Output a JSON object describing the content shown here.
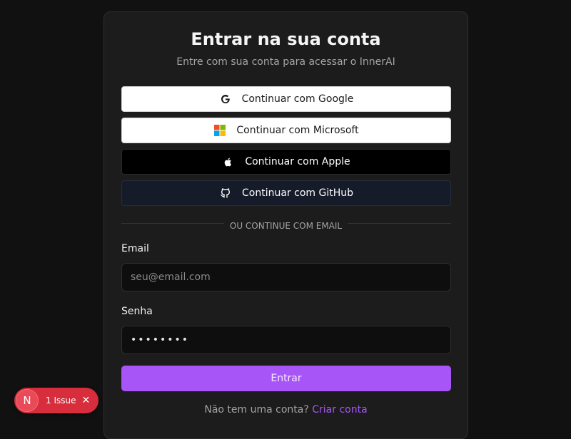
{
  "auth": {
    "title": "Entrar na sua conta",
    "subtitle": "Entre com sua conta para acessar o InnerAI",
    "oauth": {
      "google": "Continuar com Google",
      "microsoft": "Continuar com Microsoft",
      "apple": "Continuar com Apple",
      "github": "Continuar com GitHub"
    },
    "divider": "OU CONTINUE COM EMAIL",
    "email": {
      "label": "Email",
      "placeholder": "seu@email.com",
      "value": ""
    },
    "password": {
      "label": "Senha",
      "value": "••••••••"
    },
    "submit_label": "Entrar",
    "signup_prompt": "Não tem uma conta?",
    "signup_link": "Criar conta"
  },
  "dev_overlay": {
    "badge_letter": "N",
    "issues_label": "1 Issue",
    "close_glyph": "✕"
  },
  "icons": {
    "google": "google-icon",
    "microsoft": "microsoft-icon",
    "apple": "apple-icon",
    "github": "github-icon"
  },
  "colors": {
    "accent": "#a855f7",
    "background": "#111111",
    "card": "#1c1c1c",
    "issue_badge": "#d72d3c"
  }
}
